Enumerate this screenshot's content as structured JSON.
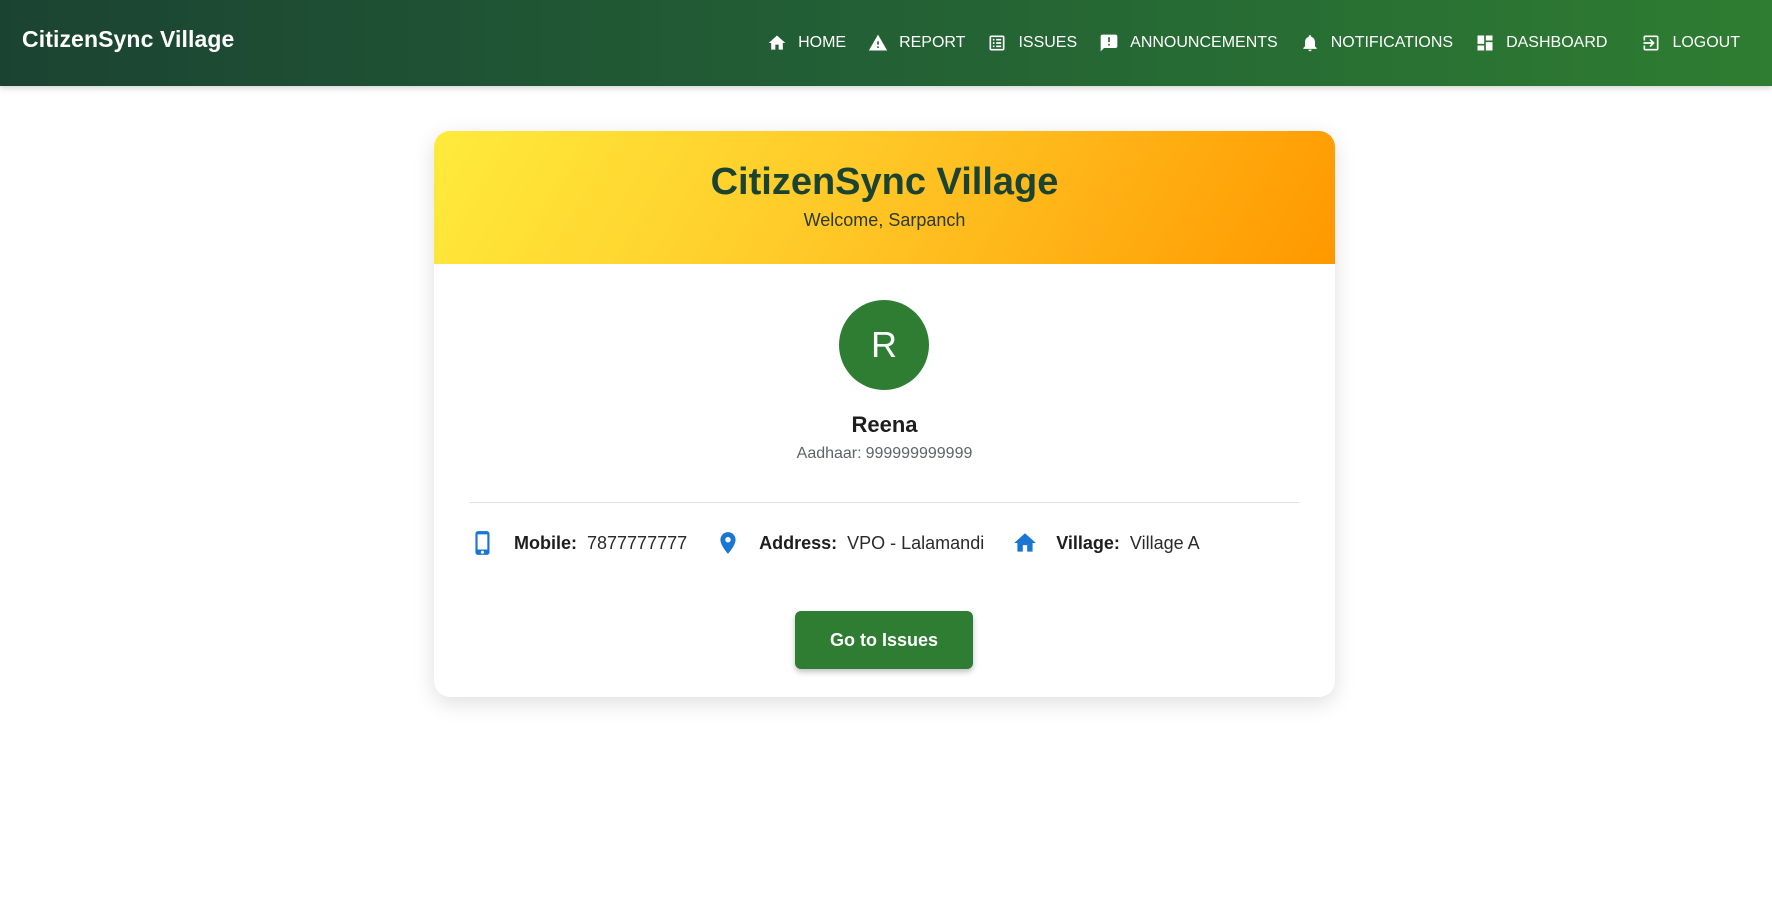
{
  "brand": "CitizenSync Village",
  "nav": {
    "items": [
      {
        "label": "HOME",
        "icon": "home-icon"
      },
      {
        "label": "REPORT",
        "icon": "warning-icon"
      },
      {
        "label": "ISSUES",
        "icon": "list-icon"
      },
      {
        "label": "ANNOUNCEMENTS",
        "icon": "announcement-icon"
      },
      {
        "label": "NOTIFICATIONS",
        "icon": "bell-icon"
      },
      {
        "label": "DASHBOARD",
        "icon": "dashboard-icon"
      },
      {
        "label": "LOGOUT",
        "icon": "logout-icon"
      }
    ]
  },
  "card": {
    "title": "CitizenSync Village",
    "subtitle": "Welcome, Sarpanch"
  },
  "profile": {
    "avatar_initial": "R",
    "name": "Reena",
    "aadhaar_label": "Aadhaar:",
    "aadhaar_value": "999999999999",
    "info": [
      {
        "label": "Mobile:",
        "value": "7877777777",
        "icon": "phone-icon"
      },
      {
        "label": "Address:",
        "value": "VPO - Lalamandi",
        "icon": "location-pin-icon"
      },
      {
        "label": "Village:",
        "value": "Village A",
        "icon": "home-icon"
      }
    ]
  },
  "actions": {
    "go_to_issues": "Go to Issues"
  },
  "colors": {
    "header_gradient_start": "#1b4332",
    "header_gradient_end": "#2e7d32",
    "banner_gradient_start": "#ffeb3b",
    "banner_gradient_end": "#ff9800",
    "primary_green": "#2e7d32",
    "icon_blue": "#1976d2"
  }
}
